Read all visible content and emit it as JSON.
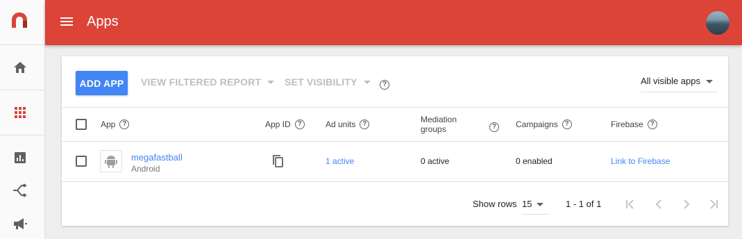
{
  "header": {
    "title": "Apps"
  },
  "rail": {
    "items": [
      {
        "name": "home-icon"
      },
      {
        "name": "apps-grid-icon"
      },
      {
        "name": "reports-icon"
      },
      {
        "name": "mediation-icon"
      },
      {
        "name": "campaigns-icon"
      }
    ]
  },
  "toolbar": {
    "add_app": "ADD APP",
    "view_filtered_report": "VIEW FILTERED REPORT",
    "set_visibility": "SET VISIBILITY",
    "help": "?",
    "visibility_filter": "All visible apps"
  },
  "table": {
    "columns": {
      "app": "App",
      "app_id": "App ID",
      "ad_units": "Ad units",
      "mediation_groups_line1": "Mediation",
      "mediation_groups_line2": "groups",
      "campaigns": "Campaigns",
      "firebase": "Firebase"
    },
    "rows": [
      {
        "app_name": "megafastball",
        "platform": "Android",
        "ad_units": "1 active",
        "mediation_groups": "0 active",
        "campaigns": "0 enabled",
        "firebase": "Link to Firebase"
      }
    ]
  },
  "footer": {
    "show_rows_label": "Show rows",
    "rows_value": "15",
    "range": "1 - 1 of 1"
  },
  "colors": {
    "header": "#db4437",
    "primary": "#4285f4"
  }
}
